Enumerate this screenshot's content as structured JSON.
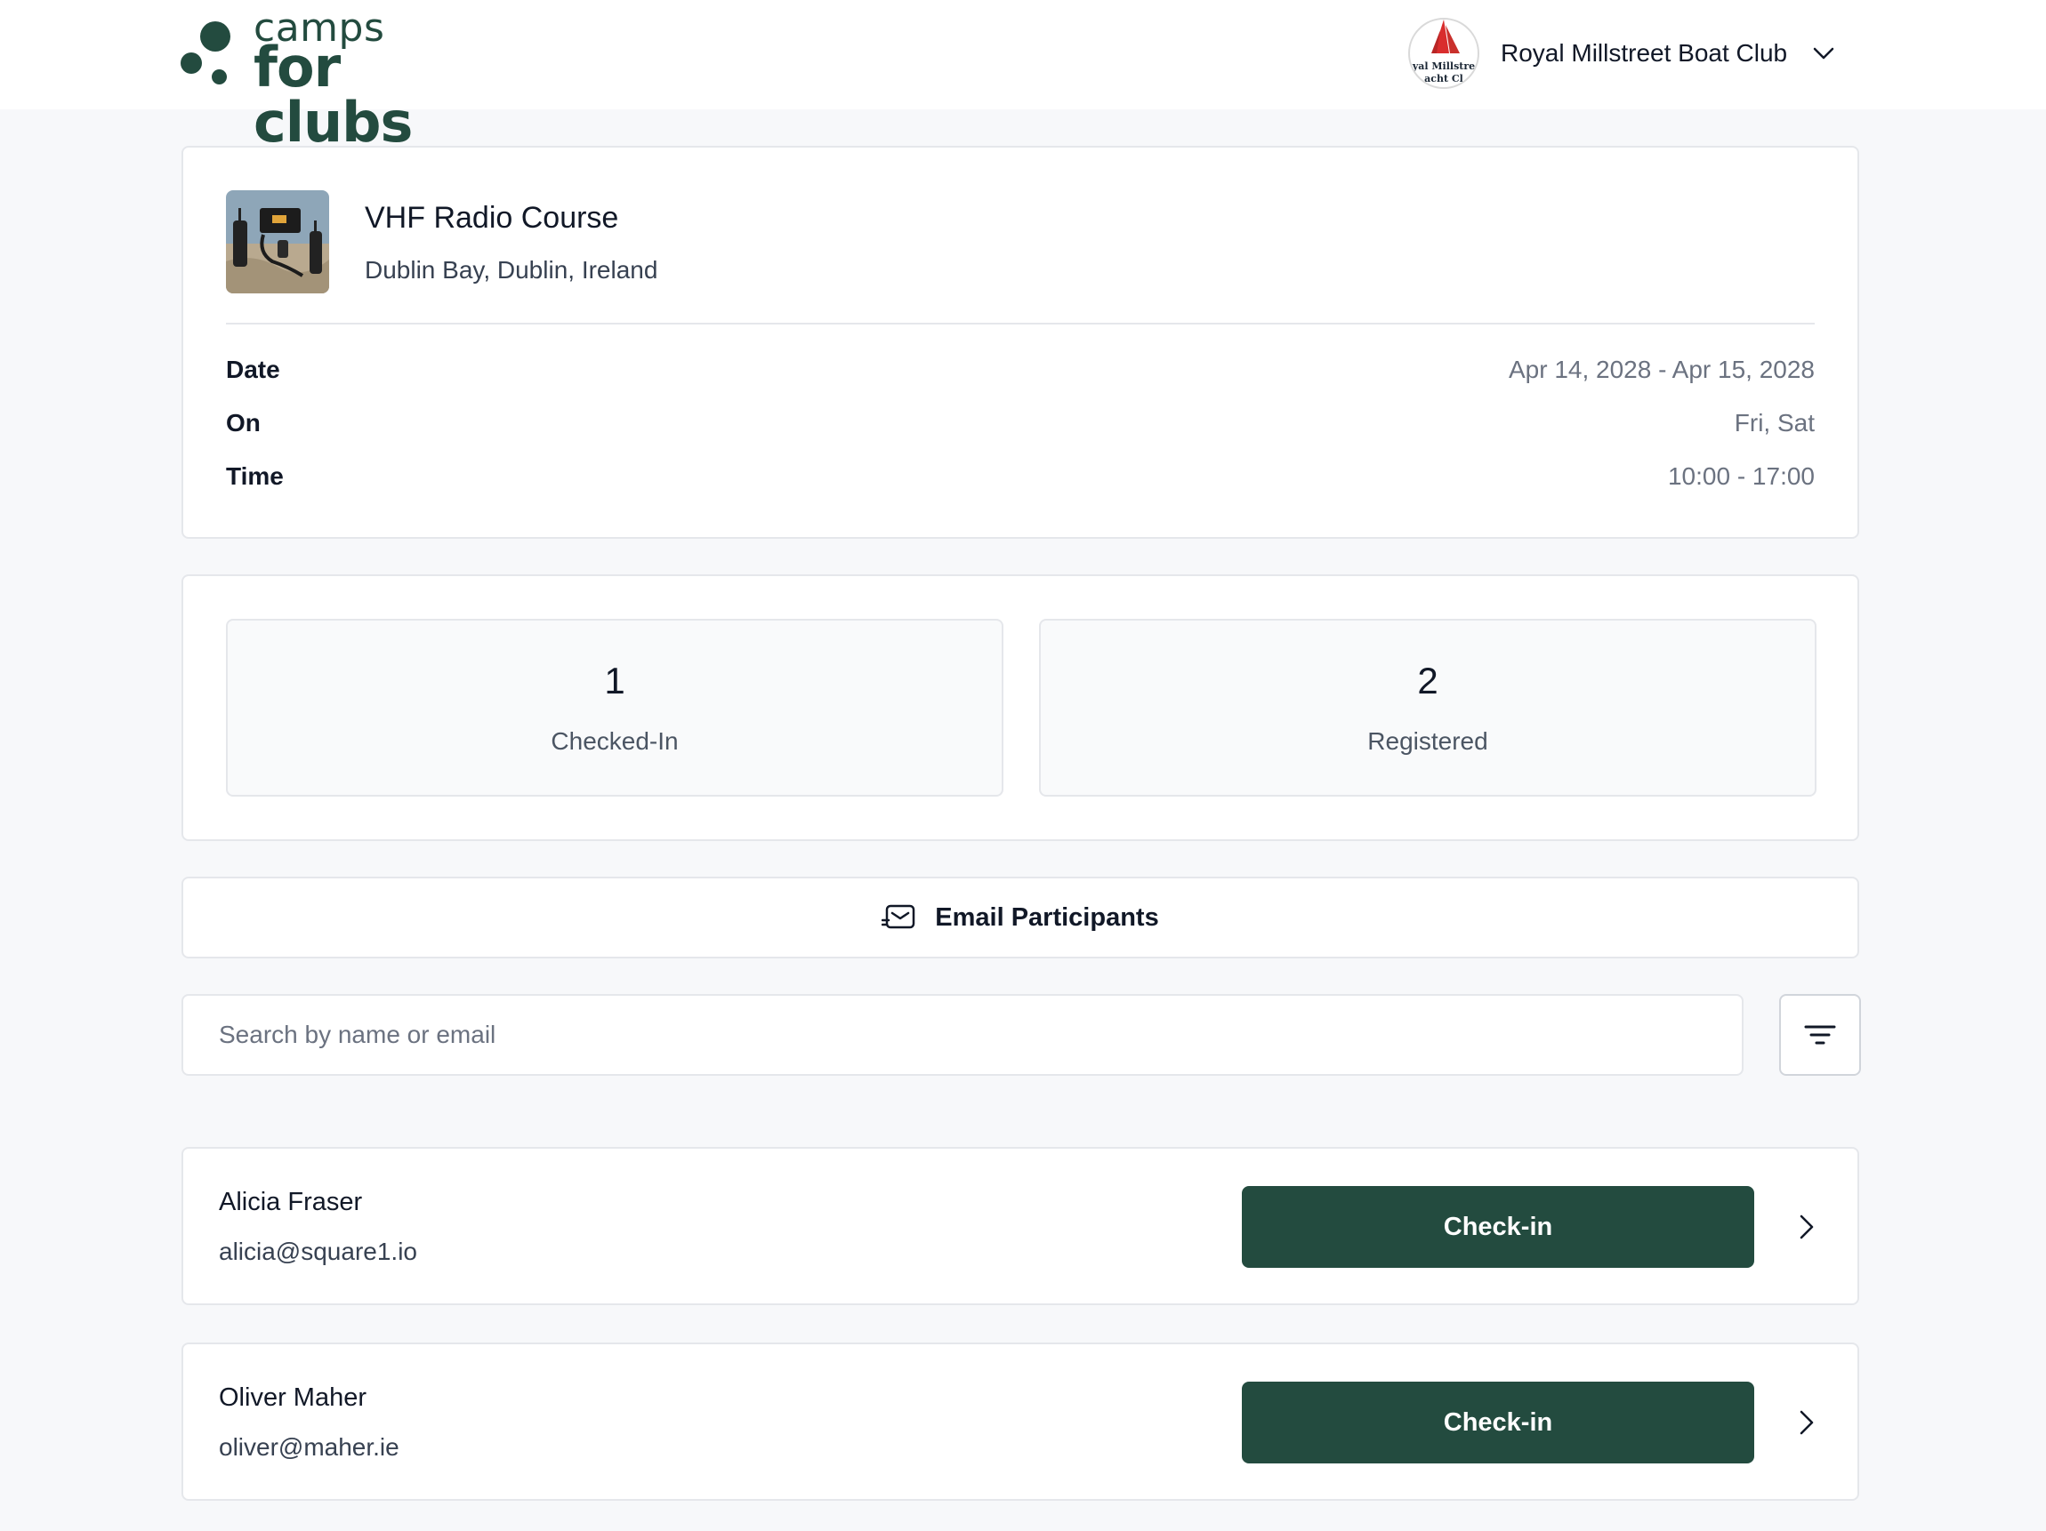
{
  "brand": {
    "line1": "camps",
    "line2": "for clubs",
    "color": "#234b3f"
  },
  "club": {
    "name": "Royal Millstreet Boat Club",
    "logo_text": "yal Millstre",
    "logo_text2": "acht Cl"
  },
  "course": {
    "title": "VHF Radio Course",
    "location": "Dublin Bay, Dublin, Ireland",
    "details": [
      {
        "label": "Date",
        "value": "Apr 14, 2028 - Apr 15, 2028"
      },
      {
        "label": "On",
        "value": "Fri, Sat"
      },
      {
        "label": "Time",
        "value": "10:00 - 17:00"
      }
    ]
  },
  "stats": [
    {
      "value": "1",
      "label": "Checked-In"
    },
    {
      "value": "2",
      "label": "Registered"
    }
  ],
  "email_button": {
    "label": "Email Participants",
    "icon": "mail-icon"
  },
  "search": {
    "placeholder": "Search by name or email",
    "value": ""
  },
  "filter": {
    "icon": "filter-icon"
  },
  "participants": [
    {
      "name": "Alicia Fraser",
      "email": "alicia@square1.io",
      "action": "Check-in"
    },
    {
      "name": "Oliver Maher",
      "email": "oliver@maher.ie",
      "action": "Check-in"
    }
  ],
  "colors": {
    "primary": "#234b3f",
    "background": "#f7f8fa",
    "border": "#e5e7eb",
    "muted": "#6b7280"
  }
}
